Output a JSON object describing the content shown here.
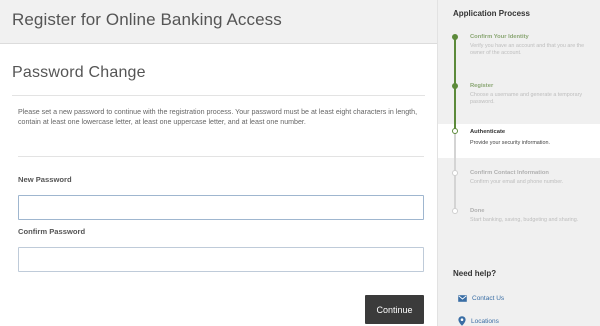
{
  "header": {
    "title": "Register for Online Banking Access"
  },
  "form": {
    "section_title": "Password Change",
    "instructions": "Please set a new password to continue with the registration process. Your password must be at least eight characters in length, contain at least one lowercase letter, at least one uppercase letter, and at least one number.",
    "new_password": {
      "label": "New Password",
      "value": "",
      "placeholder": ""
    },
    "confirm_password": {
      "label": "Confirm Password",
      "value": "",
      "placeholder": ""
    },
    "continue_label": "Continue"
  },
  "sidebar": {
    "title": "Application Process",
    "steps": [
      {
        "title": "Confirm Your Identity",
        "desc": "Verify you have an account and that you are the owner of the account.",
        "status": "done"
      },
      {
        "title": "Register",
        "desc": "Choose a username and generate a temporary password.",
        "status": "done"
      },
      {
        "title": "Authenticate",
        "desc": "Provide your security information.",
        "status": "current"
      },
      {
        "title": "Confirm Contact Information",
        "desc": "Confirm your email and phone number.",
        "status": "pending"
      },
      {
        "title": "Done",
        "desc": "Start banking, saving, budgeting and sharing.",
        "status": "pending"
      }
    ],
    "help": {
      "title": "Need help?",
      "links": [
        {
          "label": "Contact Us",
          "icon": "envelope-icon"
        },
        {
          "label": "Locations",
          "icon": "map-pin-icon"
        }
      ]
    }
  },
  "colors": {
    "accent_green": "#5c8a3a",
    "link_blue": "#3a6ea5",
    "button_dark": "#3b3b3b"
  }
}
